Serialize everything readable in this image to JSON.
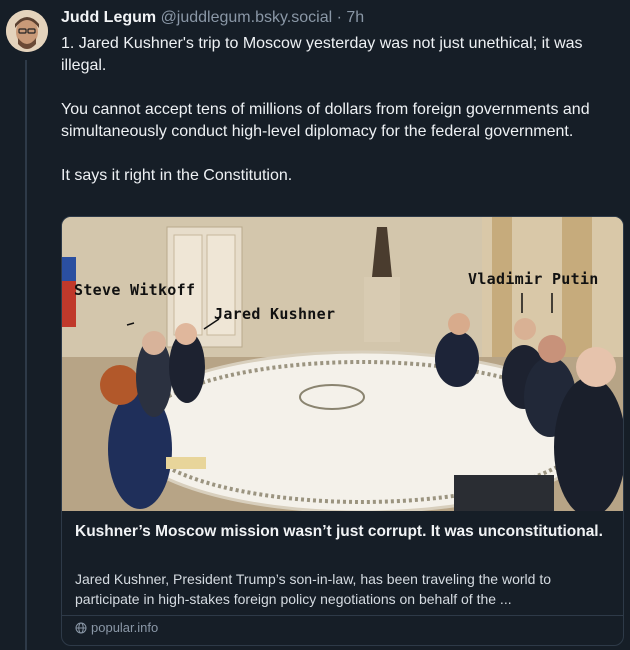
{
  "post": {
    "author_name": "Judd Legum",
    "author_handle": "@juddlegum.bsky.social",
    "separator": "·",
    "time": "7h",
    "paragraphs": [
      "1. Jared Kushner's trip to Moscow yesterday was not just unethical; it was illegal.",
      "You cannot accept tens of millions of dollars from foreign governments and simultaneously conduct high-level diplomacy for the federal government.",
      "It says it right in the Constitution."
    ]
  },
  "card": {
    "image_labels": {
      "witkoff": "Steve Witkoff",
      "kushner": "Jared Kushner",
      "putin": "Vladimir Putin"
    },
    "title": "Kushner’s Moscow mission wasn’t just corrupt. It was unconstitutional.",
    "description": "Jared Kushner, President Trump’s son-in-law, has been traveling the world to participate in high-stakes foreign policy negotiations on behalf of the ...",
    "source": "popular.info",
    "source_icon": "globe-icon"
  },
  "colors": {
    "background": "#161e27",
    "text": "#f1f3f5",
    "muted": "#8a97a6",
    "border": "#2e3a48"
  }
}
